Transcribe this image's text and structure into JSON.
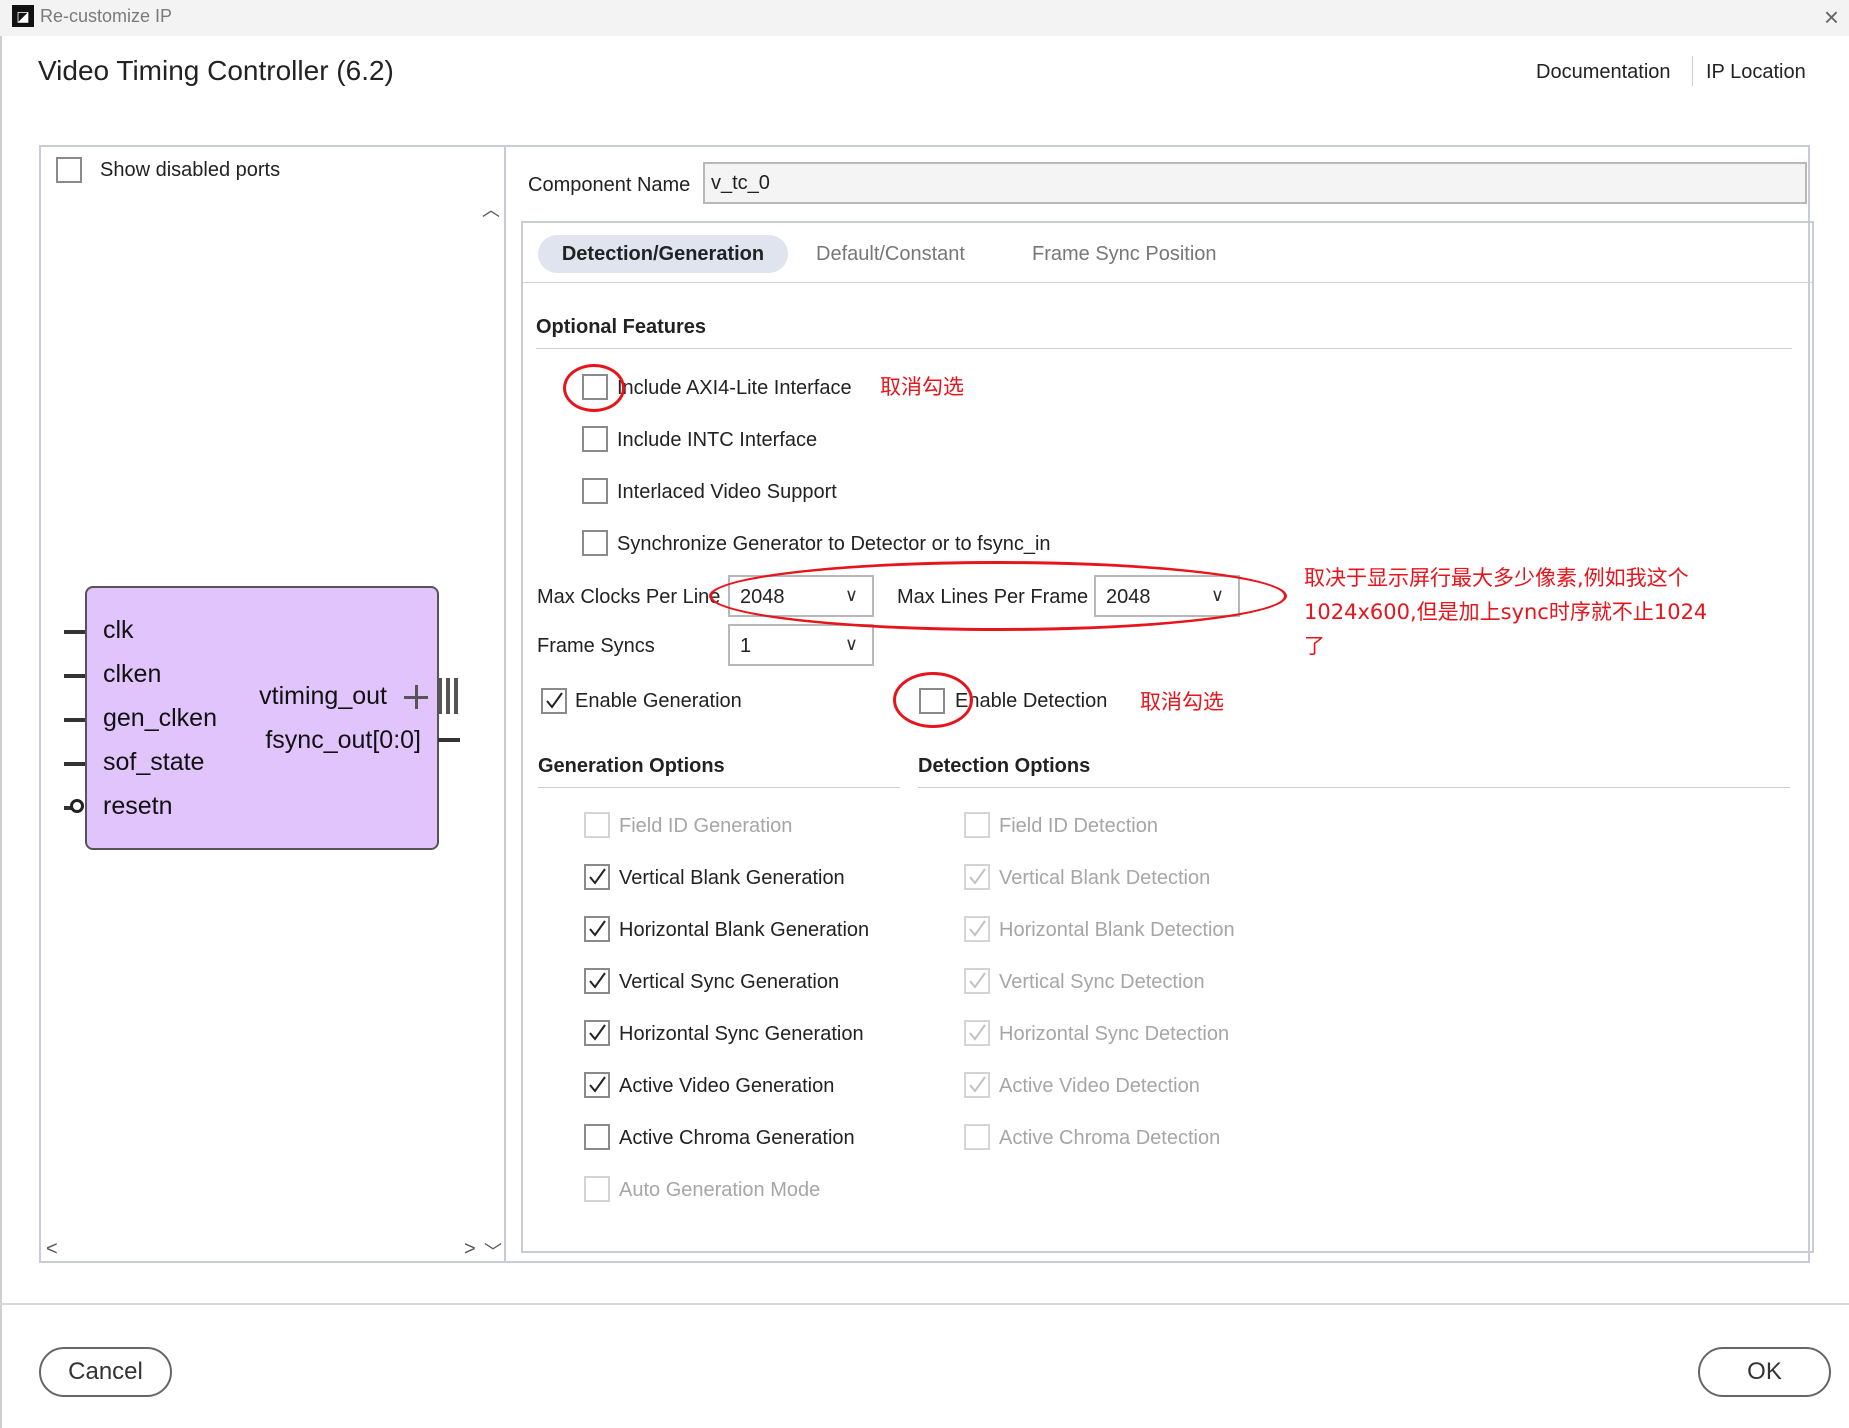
{
  "window": {
    "title": "Re-customize IP",
    "logo": "amd-logo-icon"
  },
  "dialog": {
    "title": "Video Timing Controller (6.2)"
  },
  "header_links": {
    "documentation": "Documentation",
    "ip_location": "IP Location"
  },
  "left_pane": {
    "show_disabled_ports": {
      "label": "Show disabled ports",
      "checked": false
    },
    "symbol": {
      "inputs": [
        "clk",
        "clken",
        "gen_clken",
        "sof_state",
        "resetn"
      ],
      "outputs": [
        "vtiming_out",
        "fsync_out[0:0]"
      ],
      "fill_color": "#e0c4fb"
    }
  },
  "component_name": {
    "label": "Component Name",
    "value": "v_tc_0"
  },
  "tabs": [
    {
      "label": "Detection/Generation",
      "active": true
    },
    {
      "label": "Default/Constant",
      "active": false
    },
    {
      "label": "Frame Sync Position",
      "active": false
    }
  ],
  "optional_features": {
    "title": "Optional Features",
    "items": [
      {
        "label": "Include AXI4-Lite Interface",
        "checked": false
      },
      {
        "label": "Include INTC Interface",
        "checked": false
      },
      {
        "label": "Interlaced Video Support",
        "checked": false
      },
      {
        "label": "Synchronize Generator to Detector or to fsync_in",
        "checked": false
      }
    ],
    "max_clocks": {
      "label": "Max Clocks Per Line",
      "value": "2048"
    },
    "max_lines": {
      "label": "Max Lines Per Frame",
      "value": "2048"
    },
    "frame_syncs": {
      "label": "Frame Syncs",
      "value": "1"
    },
    "enable_generation": {
      "label": "Enable Generation",
      "checked": true
    },
    "enable_detection": {
      "label": "Enable Detection",
      "checked": false
    }
  },
  "generation_options": {
    "title": "Generation Options",
    "items": [
      {
        "label": "Field ID Generation",
        "checked": false,
        "enabled": false
      },
      {
        "label": "Vertical Blank Generation",
        "checked": true,
        "enabled": true
      },
      {
        "label": "Horizontal Blank Generation",
        "checked": true,
        "enabled": true
      },
      {
        "label": "Vertical Sync Generation",
        "checked": true,
        "enabled": true
      },
      {
        "label": "Horizontal Sync Generation",
        "checked": true,
        "enabled": true
      },
      {
        "label": "Active Video Generation",
        "checked": true,
        "enabled": true
      },
      {
        "label": "Active Chroma Generation",
        "checked": false,
        "enabled": true
      },
      {
        "label": "Auto Generation Mode",
        "checked": false,
        "enabled": false
      }
    ]
  },
  "detection_options": {
    "title": "Detection Options",
    "items": [
      {
        "label": "Field ID Detection",
        "checked": false,
        "enabled": false
      },
      {
        "label": "Vertical Blank Detection",
        "checked": true,
        "enabled": false
      },
      {
        "label": "Horizontal Blank Detection",
        "checked": true,
        "enabled": false
      },
      {
        "label": "Vertical Sync Detection",
        "checked": true,
        "enabled": false
      },
      {
        "label": "Horizontal Sync Detection",
        "checked": true,
        "enabled": false
      },
      {
        "label": "Active Video Detection",
        "checked": true,
        "enabled": false
      },
      {
        "label": "Active Chroma Detection",
        "checked": false,
        "enabled": false
      }
    ]
  },
  "annotations": {
    "uncheck_axi": "取消勾选",
    "uncheck_detection": "取消勾选",
    "max_note_lines": [
      "取决于显示屏行最大多少像素,例如我这个",
      "1024x600,但是加上sync时序就不止1024",
      "了"
    ],
    "color": "#e8141b"
  },
  "buttons": {
    "cancel": "Cancel",
    "ok": "OK"
  }
}
